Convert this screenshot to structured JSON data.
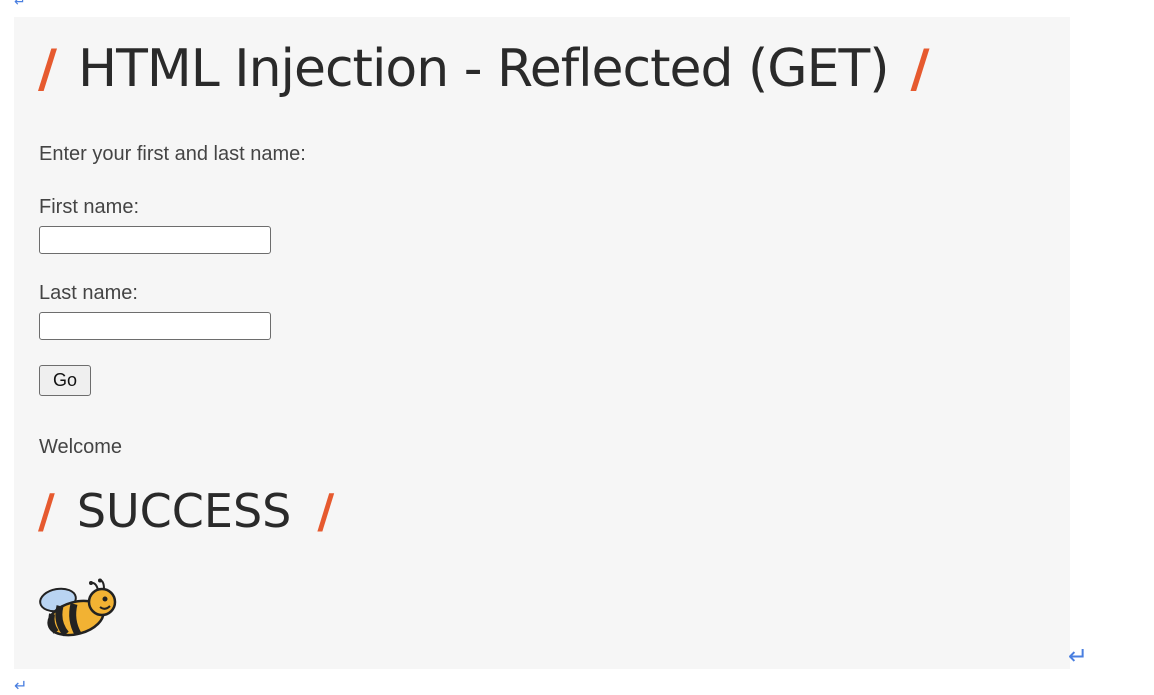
{
  "page": {
    "title": "HTML Injection - Reflected (GET)",
    "intro": "Enter your first and last name:",
    "first_name_label": "First name:",
    "first_name_value": "",
    "last_name_label": "Last name:",
    "last_name_value": "",
    "go_label": "Go",
    "welcome": "Welcome",
    "success": "SUCCESS",
    "slash": "/"
  },
  "colors": {
    "accent": "#e65a2f",
    "panel_bg": "#f6f6f6",
    "text": "#444444",
    "heading": "#2a2a2a",
    "return_arrow": "#4a7fe0"
  },
  "icons": {
    "bee": "bee-mascot-icon",
    "return": "return-arrow-icon"
  }
}
